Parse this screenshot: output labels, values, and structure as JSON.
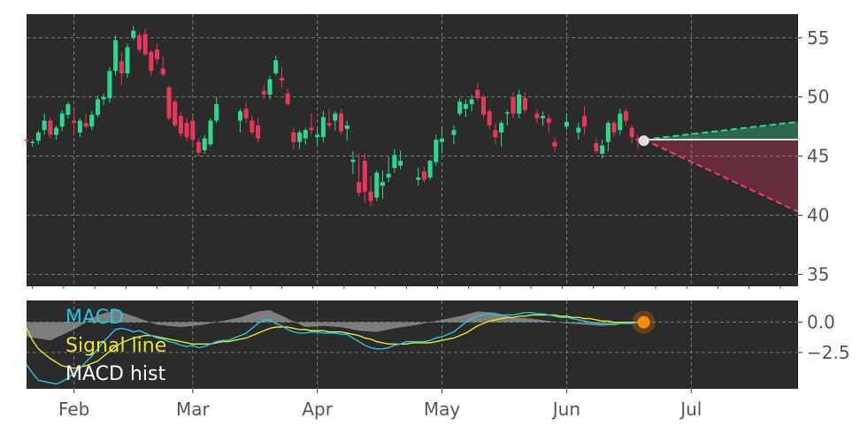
{
  "colors": {
    "background": "#ffffff",
    "panel": "#2b2b2b",
    "grid": "#8a8a8a",
    "up": "#2bd98e",
    "down": "#e8375a",
    "macd": "#22c5df",
    "signal": "#e6e62a",
    "hist": "#9a9a9a",
    "forecast_up": "#2bd98e",
    "forecast_down": "#ff3366",
    "marker": "#e0e0e0",
    "macd_marker": "#ff8c00",
    "tick_text": "#555555",
    "legend_text": "#ffffff"
  },
  "chart_data": [
    {
      "type": "candlestick",
      "title": "",
      "ylim": [
        34,
        57
      ],
      "yticks": [
        "35",
        "40",
        "45",
        "50",
        "55"
      ],
      "xlim": [
        0,
        130
      ],
      "xtick_positions": [
        8,
        28,
        49,
        70,
        91,
        112
      ],
      "grid": true,
      "candles": [
        [
          0,
          46.4,
          46.6,
          45.9,
          46.3
        ],
        [
          1,
          46.1,
          46.4,
          45.8,
          46.2
        ],
        [
          2,
          46.3,
          47.2,
          46.0,
          47.0
        ],
        [
          3,
          47.2,
          48.6,
          46.8,
          48.0
        ],
        [
          4,
          48.0,
          48.2,
          46.5,
          46.8
        ],
        [
          5,
          46.8,
          47.6,
          46.4,
          47.4
        ],
        [
          6,
          47.5,
          48.9,
          47.1,
          48.6
        ],
        [
          7,
          48.5,
          49.6,
          48.2,
          49.4
        ],
        [
          8,
          48.0,
          49.0,
          46.8,
          47.8
        ],
        [
          9,
          47.0,
          48.2,
          46.6,
          48.0
        ],
        [
          10,
          47.8,
          48.6,
          47.3,
          47.5
        ],
        [
          11,
          47.5,
          48.8,
          47.2,
          48.5
        ],
        [
          12,
          48.5,
          50.1,
          48.3,
          49.8
        ],
        [
          13,
          49.8,
          50.3,
          49.3,
          50.0
        ],
        [
          14,
          49.9,
          52.5,
          49.5,
          52.2
        ],
        [
          15,
          52.2,
          55.2,
          51.8,
          54.8
        ],
        [
          16,
          53.0,
          53.8,
          51.0,
          52.0
        ],
        [
          17,
          52.0,
          54.5,
          51.6,
          54.2
        ],
        [
          18,
          55.0,
          56.0,
          54.8,
          55.6
        ],
        [
          19,
          55.2,
          55.4,
          53.8,
          54.0
        ],
        [
          20,
          55.3,
          55.8,
          53.5,
          53.6
        ],
        [
          21,
          53.8,
          54.0,
          51.8,
          52.2
        ],
        [
          22,
          54.0,
          54.5,
          52.8,
          53.2
        ],
        [
          23,
          52.4,
          53.4,
          51.7,
          51.9
        ],
        [
          24,
          50.8,
          51.0,
          48.0,
          48.2
        ],
        [
          25,
          49.6,
          49.8,
          47.4,
          47.6
        ],
        [
          26,
          48.4,
          48.7,
          46.6,
          46.9
        ],
        [
          27,
          47.8,
          48.2,
          46.2,
          46.6
        ],
        [
          28,
          48.0,
          48.4,
          46.0,
          46.4
        ],
        [
          29,
          46.2,
          46.5,
          45.0,
          45.3
        ],
        [
          30,
          45.5,
          46.8,
          45.2,
          46.5
        ],
        [
          31,
          46.0,
          48.2,
          45.8,
          48.0
        ],
        [
          32,
          48.0,
          50.0,
          47.8,
          49.4
        ],
        [
          36,
          48.0,
          49.0,
          47.0,
          48.8
        ],
        [
          37,
          49.0,
          49.5,
          47.8,
          48.2
        ],
        [
          38,
          48.0,
          48.4,
          46.8,
          47.0
        ],
        [
          39,
          47.6,
          48.2,
          46.2,
          46.5
        ],
        [
          40,
          50.5,
          51.0,
          49.8,
          50.2
        ],
        [
          41,
          50.2,
          51.8,
          49.8,
          51.5
        ],
        [
          42,
          52.0,
          53.5,
          51.8,
          53.1
        ],
        [
          43,
          51.6,
          52.5,
          50.8,
          51.4
        ],
        [
          44,
          50.3,
          50.7,
          49.2,
          49.4
        ],
        [
          45,
          47.0,
          47.4,
          45.6,
          46.2
        ],
        [
          46,
          46.2,
          47.2,
          45.6,
          47.0
        ],
        [
          47,
          46.5,
          47.4,
          46.0,
          47.2
        ],
        [
          48,
          47.4,
          48.6,
          46.8,
          47.2
        ],
        [
          49,
          46.6,
          47.4,
          45.9,
          46.8
        ],
        [
          50,
          46.6,
          48.8,
          46.2,
          48.3
        ],
        [
          51,
          47.8,
          48.9,
          47.4,
          47.6
        ],
        [
          52,
          48.0,
          48.8,
          47.2,
          48.6
        ],
        [
          53,
          48.6,
          49.0,
          46.8,
          47.1
        ],
        [
          54,
          47.3,
          48.0,
          46.3,
          47.6
        ],
        [
          55,
          44.5,
          45.4,
          43.5,
          44.7
        ],
        [
          56,
          42.8,
          45.2,
          41.6,
          41.9
        ],
        [
          57,
          44.6,
          45.2,
          41.0,
          42.0
        ],
        [
          58,
          42.0,
          43.3,
          40.8,
          41.2
        ],
        [
          59,
          41.5,
          43.8,
          41.2,
          43.6
        ],
        [
          60,
          42.5,
          43.8,
          41.4,
          42.8
        ],
        [
          61,
          43.2,
          44.9,
          42.8,
          43.5
        ],
        [
          62,
          44.0,
          45.6,
          43.6,
          45.1
        ],
        [
          63,
          44.2,
          45.5,
          43.9,
          44.6
        ],
        [
          66,
          43.0,
          44.0,
          42.5,
          43.2
        ],
        [
          67,
          43.7,
          44.1,
          42.8,
          43.0
        ],
        [
          68,
          43.2,
          44.7,
          43.0,
          44.6
        ],
        [
          69,
          44.5,
          46.8,
          44.2,
          46.4
        ],
        [
          70,
          46.2,
          47.4,
          45.3,
          46.5
        ],
        [
          72,
          46.8,
          47.6,
          46.0,
          47.2
        ],
        [
          73,
          48.6,
          49.9,
          48.4,
          49.6
        ],
        [
          74,
          49.0,
          49.8,
          48.3,
          49.4
        ],
        [
          75,
          49.4,
          50.2,
          48.8,
          49.8
        ],
        [
          76,
          50.6,
          51.2,
          49.7,
          49.9
        ],
        [
          77,
          50.0,
          50.2,
          48.2,
          48.5
        ],
        [
          78,
          48.8,
          49.0,
          47.3,
          47.6
        ],
        [
          79,
          47.2,
          47.8,
          46.0,
          46.6
        ],
        [
          80,
          47.0,
          48.0,
          45.8,
          47.8
        ],
        [
          81,
          48.6,
          48.9,
          47.6,
          48.7
        ],
        [
          82,
          50.0,
          50.4,
          48.2,
          48.6
        ],
        [
          83,
          48.6,
          50.6,
          48.2,
          50.2
        ],
        [
          84,
          49.9,
          50.4,
          48.6,
          48.9
        ],
        [
          86,
          48.6,
          48.9,
          47.8,
          48.2
        ],
        [
          87,
          48.2,
          48.8,
          47.6,
          48.4
        ],
        [
          88,
          48.2,
          48.5,
          47.0,
          47.8
        ],
        [
          89,
          46.2,
          46.6,
          45.4,
          45.8
        ],
        [
          91,
          47.5,
          48.6,
          47.2,
          47.9
        ],
        [
          93,
          47.0,
          47.8,
          46.4,
          47.4
        ],
        [
          94,
          48.4,
          49.2,
          46.8,
          47.5
        ],
        [
          96,
          46.1,
          46.5,
          45.2,
          45.4
        ],
        [
          97,
          45.2,
          46.4,
          44.8,
          45.9
        ],
        [
          98,
          46.2,
          48.0,
          45.4,
          47.8
        ],
        [
          99,
          47.8,
          48.0,
          46.6,
          47.0
        ],
        [
          100,
          47.2,
          49.0,
          46.8,
          48.6
        ],
        [
          101,
          48.8,
          49.0,
          47.6,
          48.0
        ],
        [
          102,
          47.4,
          47.6,
          46.1,
          46.6
        ],
        [
          103,
          46.5,
          46.8,
          45.6,
          46.3
        ]
      ],
      "last_price": {
        "x": 104,
        "y": 46.3
      },
      "forecast": {
        "x_start": 104,
        "x_end": 130,
        "baseline": 46.4,
        "upper_end": 47.9,
        "lower_end": 40.3
      }
    },
    {
      "type": "line",
      "title": "",
      "ylim": [
        -5.5,
        1.8
      ],
      "yticks": [
        "0.0",
        "−2.5"
      ],
      "ytick_values": [
        0,
        -2.5
      ],
      "xlim": [
        0,
        130
      ],
      "grid": true,
      "legend_position": "upper-left",
      "series": [
        {
          "name": "MACD",
          "x": [
            0,
            1,
            2,
            3,
            4,
            5,
            6,
            7,
            8,
            9,
            10,
            11,
            12,
            13,
            14,
            15,
            16,
            17,
            18,
            19,
            20,
            21,
            22,
            23,
            24,
            25,
            26,
            27,
            28,
            29,
            30,
            31,
            32,
            33,
            34,
            35,
            36,
            37,
            38,
            39,
            40,
            41,
            42,
            43,
            44,
            45,
            46,
            47,
            48,
            49,
            50,
            51,
            52,
            53,
            54,
            55,
            56,
            57,
            58,
            59,
            60,
            61,
            62,
            63,
            64,
            65,
            66,
            67,
            68,
            69,
            70,
            71,
            72,
            73,
            74,
            75,
            76,
            77,
            78,
            79,
            80,
            81,
            82,
            83,
            84,
            85,
            86,
            87,
            88,
            89,
            90,
            91,
            92,
            93,
            94,
            95,
            96,
            97,
            98,
            99,
            100,
            101,
            102,
            103,
            104
          ],
          "y": [
            -3.5,
            -4.2,
            -4.8,
            -4.9,
            -5.0,
            -5.1,
            -4.9,
            -4.6,
            -4.2,
            -3.8,
            -3.3,
            -2.8,
            -2.2,
            -1.6,
            -1.1,
            -0.6,
            -0.5,
            -0.6,
            -0.8,
            -0.7,
            -0.9,
            -1.1,
            -1.3,
            -1.4,
            -1.6,
            -1.7,
            -1.9,
            -2.0,
            -1.9,
            -2.1,
            -2.0,
            -1.8,
            -1.6,
            -1.5,
            -1.5,
            -1.3,
            -1.1,
            -0.9,
            -0.5,
            -0.1,
            0.2,
            0.2,
            -0.1,
            -0.3,
            -0.6,
            -0.8,
            -0.9,
            -0.9,
            -0.8,
            -0.8,
            -0.9,
            -0.9,
            -0.9,
            -1.0,
            -1.0,
            -1.3,
            -1.6,
            -1.9,
            -2.1,
            -2.2,
            -2.2,
            -2.1,
            -1.9,
            -1.8,
            -1.6,
            -1.6,
            -1.6,
            -1.6,
            -1.5,
            -1.3,
            -1.2,
            -1.0,
            -0.8,
            -0.4,
            0.0,
            0.3,
            0.5,
            0.6,
            0.7,
            0.6,
            0.6,
            0.6,
            0.6,
            0.7,
            0.8,
            0.8,
            0.7,
            0.7,
            0.6,
            0.5,
            0.4,
            0.4,
            0.3,
            0.2,
            0.1,
            0.0,
            -0.1,
            -0.2,
            -0.2,
            -0.2,
            -0.1,
            -0.1,
            -0.1,
            0.0,
            0.0
          ]
        },
        {
          "name": "Signal line",
          "x": [
            0,
            1,
            2,
            3,
            4,
            5,
            6,
            7,
            8,
            9,
            10,
            11,
            12,
            13,
            14,
            15,
            16,
            17,
            18,
            19,
            20,
            21,
            22,
            23,
            24,
            25,
            26,
            27,
            28,
            29,
            30,
            31,
            32,
            33,
            34,
            35,
            36,
            37,
            38,
            39,
            40,
            41,
            42,
            43,
            44,
            45,
            46,
            47,
            48,
            49,
            50,
            51,
            52,
            53,
            54,
            55,
            56,
            57,
            58,
            59,
            60,
            61,
            62,
            63,
            64,
            65,
            66,
            67,
            68,
            69,
            70,
            71,
            72,
            73,
            74,
            75,
            76,
            77,
            78,
            79,
            80,
            81,
            82,
            83,
            84,
            85,
            86,
            87,
            88,
            89,
            90,
            91,
            92,
            93,
            94,
            95,
            96,
            97,
            98,
            99,
            100,
            101,
            102,
            103,
            104
          ],
          "y": [
            -0.5,
            -1.5,
            -2.2,
            -2.6,
            -3.0,
            -3.3,
            -3.6,
            -3.7,
            -3.8,
            -3.7,
            -3.6,
            -3.4,
            -3.2,
            -2.8,
            -2.4,
            -2.0,
            -1.7,
            -1.5,
            -1.3,
            -1.2,
            -1.1,
            -1.1,
            -1.2,
            -1.3,
            -1.4,
            -1.5,
            -1.6,
            -1.7,
            -1.8,
            -1.8,
            -1.8,
            -1.8,
            -1.7,
            -1.6,
            -1.6,
            -1.5,
            -1.4,
            -1.3,
            -1.1,
            -0.9,
            -0.7,
            -0.5,
            -0.4,
            -0.4,
            -0.4,
            -0.5,
            -0.6,
            -0.6,
            -0.7,
            -0.7,
            -0.7,
            -0.8,
            -0.8,
            -0.8,
            -0.9,
            -1.0,
            -1.1,
            -1.3,
            -1.4,
            -1.6,
            -1.7,
            -1.8,
            -1.8,
            -1.8,
            -1.8,
            -1.7,
            -1.7,
            -1.7,
            -1.7,
            -1.6,
            -1.5,
            -1.4,
            -1.3,
            -1.1,
            -0.9,
            -0.6,
            -0.3,
            -0.1,
            0.1,
            0.2,
            0.3,
            0.4,
            0.4,
            0.5,
            0.5,
            0.6,
            0.6,
            0.6,
            0.6,
            0.6,
            0.5,
            0.5,
            0.4,
            0.4,
            0.3,
            0.3,
            0.2,
            0.1,
            0.1,
            0.0,
            0.0,
            0.0,
            0.0,
            0.0,
            0.0
          ]
        },
        {
          "name": "MACD hist",
          "x": [
            0,
            4,
            8,
            12,
            15,
            18,
            22,
            26,
            30,
            33,
            36,
            39,
            41,
            44,
            47,
            50,
            53,
            56,
            59,
            62,
            66,
            70,
            73,
            76,
            79,
            82,
            85,
            88,
            91,
            94,
            97,
            100,
            104
          ],
          "y": [
            -1.2,
            -1.5,
            -0.6,
            0.6,
            1.0,
            0.5,
            -0.2,
            -0.4,
            -0.2,
            0.1,
            0.4,
            0.9,
            1.0,
            0.3,
            -0.4,
            -0.3,
            -0.4,
            -0.7,
            -0.8,
            -0.5,
            -0.2,
            0.2,
            0.5,
            0.9,
            0.8,
            0.4,
            0.3,
            0.1,
            -0.1,
            -0.2,
            -0.3,
            -0.1,
            0.0
          ]
        }
      ],
      "last_point": {
        "x": 104,
        "y": 0.0
      }
    }
  ],
  "xaxis": {
    "tick_labels": [
      "Feb",
      "Mar",
      "Apr",
      "May",
      "Jun",
      "Jul"
    ]
  }
}
